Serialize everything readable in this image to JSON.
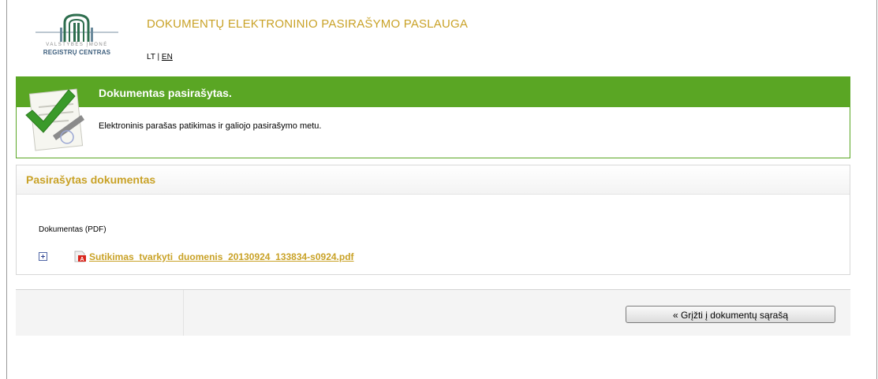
{
  "header": {
    "logo_line1": "VALSTYBĖS ĮMONĖ",
    "logo_line2": "REGISTRŲ CENTRAS",
    "title": "DOKUMENTŲ ELEKTRONINIO PASIRAŠYMO PASLAUGA",
    "lang_lt": "LT",
    "lang_sep": "|",
    "lang_en": "EN"
  },
  "status": {
    "title": "Dokumentas pasirašytas.",
    "message": "Elektroninis parašas patikimas ir galiojo pasirašymo metu."
  },
  "document": {
    "section_title": "Pasirašytas dokumentas",
    "label": "Dokumentas (PDF)",
    "filename": "Sutikimas_tvarkyti_duomenis_20130924_133834-s0924.pdf"
  },
  "actions": {
    "back_label": "« Grįžti į dokumentų sąrašą"
  },
  "colors": {
    "accent": "#c9a227",
    "success": "#5aa624"
  }
}
